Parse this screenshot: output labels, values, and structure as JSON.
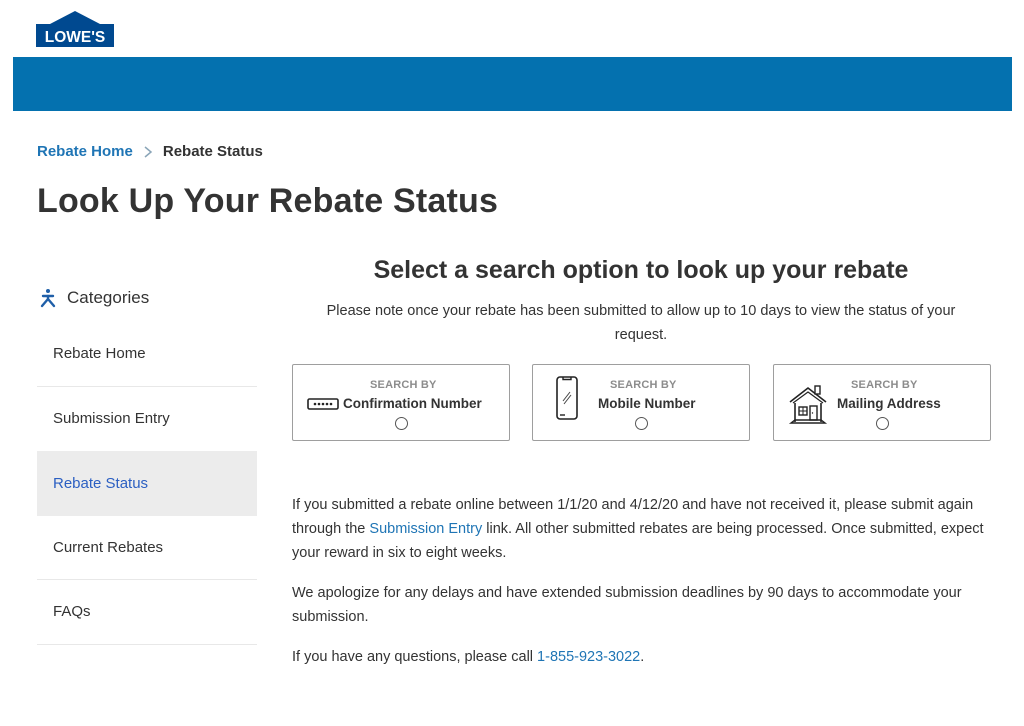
{
  "brand": {
    "logo_text": "LOWE'S",
    "primary_color": "#0471af",
    "logo_color": "#004990",
    "link_color": "#1f75b5",
    "active_nav_color": "#2b5fc2"
  },
  "breadcrumb": {
    "home_label": "Rebate Home",
    "current_label": "Rebate Status"
  },
  "page": {
    "title": "Look Up Your Rebate Status"
  },
  "sidebar": {
    "header_icon": "categories-icon",
    "header_label": "Categories",
    "items": [
      {
        "label": "Rebate Home",
        "active": false
      },
      {
        "label": "Submission Entry",
        "active": false
      },
      {
        "label": "Rebate Status",
        "active": true
      },
      {
        "label": "Current Rebates",
        "active": false
      },
      {
        "label": "FAQs",
        "active": false
      }
    ]
  },
  "main": {
    "section_title": "Select a search option to look up your rebate",
    "note": "Please note once your rebate has been submitted to allow up to 10 days to view the status of your request.",
    "options": [
      {
        "small_label": "SEARCH BY",
        "label": "Confirmation Number",
        "icon": "password-dots-icon",
        "selected": false
      },
      {
        "small_label": "SEARCH BY",
        "label": "Mobile Number",
        "icon": "mobile-phone-icon",
        "selected": false
      },
      {
        "small_label": "SEARCH BY",
        "label": "Mailing Address",
        "icon": "house-icon",
        "selected": false
      }
    ],
    "paragraph1_before": "If you submitted a rebate online between 1/1/20 and 4/12/20 and have not received it, please submit again through the ",
    "paragraph1_link": "Submission Entry",
    "paragraph1_after": " link. All other submitted rebates are being processed. Once submitted, expect your reward in six to eight weeks.",
    "paragraph2": "We apologize for any delays and have extended submission deadlines by 90 days to accommodate your submission.",
    "paragraph3_before": "If you have any questions, please call ",
    "paragraph3_phone": "1-855-923-3022",
    "paragraph3_after": "."
  }
}
